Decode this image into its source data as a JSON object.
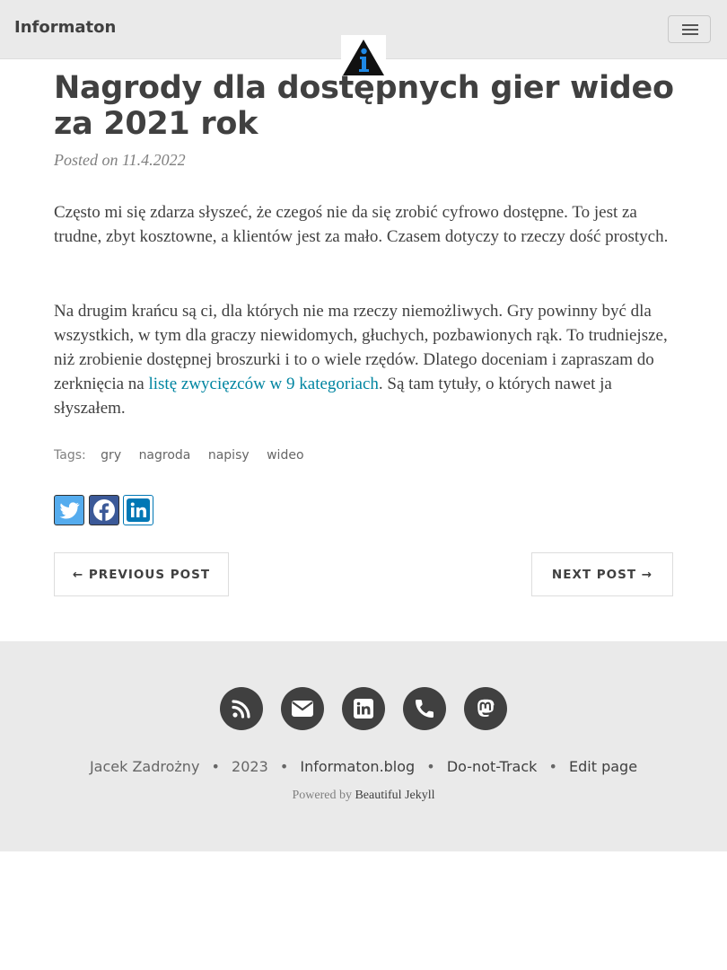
{
  "navbar": {
    "brand": "Informaton",
    "menu_icon": "hamburger-menu-icon",
    "logo_icon": "info-triangle-logo-icon"
  },
  "post": {
    "title": "Nagrody dla dostępnych gier wideo za 2021 rok",
    "meta": "Posted on 11.4.2022",
    "paragraph1": "Często mi się zdarza słyszeć, że czegoś nie da się zrobić cyfrowo dostępne. To jest za trudne, zbyt kosztowne, a klientów jest za mało. Czasem dotyczy to rzeczy dość prostych.",
    "paragraph2_before": "Na drugim krańcu są ci, dla których nie ma rzeczy niemożliwych. Gry powinny być dla wszystkich, w tym dla graczy niewidomych, głuchych, pozbawionych rąk. To trudniejsze, niż zrobienie dostępnej broszurki i to o wiele rzędów. Dlatego doceniam i zapraszam do zerknięcia na ",
    "paragraph2_link": "listę zwycięzców w 9 kategoriach",
    "paragraph2_after": ". Są tam tytuły, o których nawet ja słyszałem."
  },
  "tags": {
    "label": "Tags:",
    "items": [
      "gry",
      "nagroda",
      "napisy",
      "wideo"
    ]
  },
  "share": {
    "twitter_icon": "twitter-icon",
    "facebook_icon": "facebook-icon",
    "linkedin_icon": "linkedin-icon"
  },
  "pager": {
    "previous": "← PREVIOUS POST",
    "next": "NEXT POST →"
  },
  "footer": {
    "icons": [
      "rss-icon",
      "envelope-icon",
      "linkedin-icon",
      "phone-icon",
      "mastodon-icon"
    ],
    "author": "Jacek Zadrożny",
    "year": "2023",
    "blog": "Informaton.blog",
    "dnt": "Do-not-Track",
    "edit": "Edit page",
    "powered_prefix": "Powered by",
    "powered_link": "Beautiful Jekyll"
  },
  "colors": {
    "link": "#0085a1",
    "twitter": "#55acee",
    "facebook": "#3b5998",
    "linkedin": "#0077b5",
    "footer_bg": "#eaeaea"
  }
}
